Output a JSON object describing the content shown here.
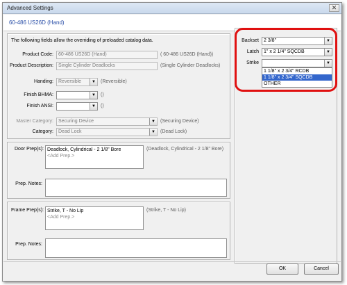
{
  "window": {
    "title": "Advanced Settings",
    "close_glyph": "✕",
    "header": "60-486 US26D (Hand)"
  },
  "intro": "The following fields allow the overriding of preloaded catalog data.",
  "fields": {
    "product_code": {
      "label": "Product Code:",
      "value": "60-486 US26D (Hand)",
      "hint": "( 60-486 US26D (Hand))"
    },
    "product_description": {
      "label": "Product Description:",
      "value": "Single Cylinder Deadlocks",
      "hint": "(Single Cylinder Deadlocks)"
    },
    "handing": {
      "label": "Handing:",
      "value": "Reversible",
      "hint": "(Reversible)"
    },
    "finish_bhma": {
      "label": "Finish BHMA:",
      "value": "",
      "hint": "()"
    },
    "finish_ansi": {
      "label": "Finish ANSI:",
      "value": "",
      "hint": "()"
    },
    "master_category": {
      "label": "Master Category:",
      "value": "Securing Device",
      "hint": "(Securing Device)"
    },
    "category": {
      "label": "Category:",
      "value": "Dead Lock",
      "hint": "(Dead Lock)"
    }
  },
  "door": {
    "label": "Door Prep(s):",
    "items": [
      "Deadlock, Cylindrical - 2 1/8\" Bore",
      "<Add Prep.>"
    ],
    "hint": "(Deadlock, Cylindrical - 2 1/8\" Bore)",
    "notes_label": "Prep. Notes:"
  },
  "frame": {
    "label": "Frame Prep(s):",
    "items": [
      "Strike, T - No Lip",
      "<Add Prep.>"
    ],
    "hint": "(Strike, T - No Lip)",
    "notes_label": "Prep. Notes:"
  },
  "right_panel": {
    "backset": {
      "label": "Backset",
      "value": "2 3/8\""
    },
    "latch": {
      "label": "Latch",
      "value": "1\" x 2 1/4\" SQCDB"
    },
    "strike": {
      "label": "Strike",
      "value": ""
    },
    "strike_options": [
      "1 1/8\" x 2 3/4\" RCDB",
      "1 1/8\" x 2 3/4\" SQCDB",
      "OTHER"
    ],
    "strike_selected_index": 1
  },
  "buttons": {
    "ok": "OK",
    "cancel": "Cancel"
  },
  "dropdown_glyph": "▼",
  "colors": {
    "highlight_ring": "#e01010",
    "header_text": "#2a4fa8",
    "selection": "#3366cc"
  }
}
